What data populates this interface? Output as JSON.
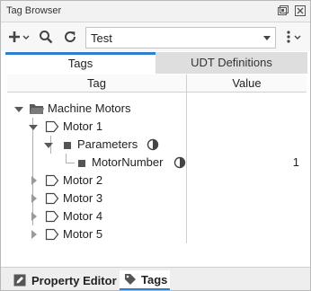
{
  "window": {
    "title": "Tag Browser"
  },
  "toolbar": {
    "provider_value": "Test"
  },
  "tabs": [
    {
      "label": "Tags"
    },
    {
      "label": "UDT Definitions"
    }
  ],
  "table": {
    "headers": {
      "tag": "Tag",
      "value": "Value"
    },
    "rows": [
      {
        "label": "Machine Motors",
        "value": ""
      },
      {
        "label": "Motor 1",
        "value": ""
      },
      {
        "label": "Parameters",
        "value": ""
      },
      {
        "label": "MotorNumber",
        "value": "1"
      },
      {
        "label": "Motor 2",
        "value": ""
      },
      {
        "label": "Motor 3",
        "value": ""
      },
      {
        "label": "Motor 4",
        "value": ""
      },
      {
        "label": "Motor 5",
        "value": ""
      }
    ]
  },
  "dock": {
    "tabs": [
      {
        "label": "Property Editor"
      },
      {
        "label": "Tags"
      }
    ]
  },
  "colors": {
    "accent": "#2f7fd0"
  },
  "icons": [
    "restore-icon",
    "close-icon",
    "add-icon",
    "search-icon",
    "refresh-icon",
    "more-icon",
    "folder-icon",
    "udt-instance-icon",
    "parameters-icon",
    "memory-tag-icon",
    "tag-state-icon",
    "edit-icon",
    "tag-icon"
  ]
}
